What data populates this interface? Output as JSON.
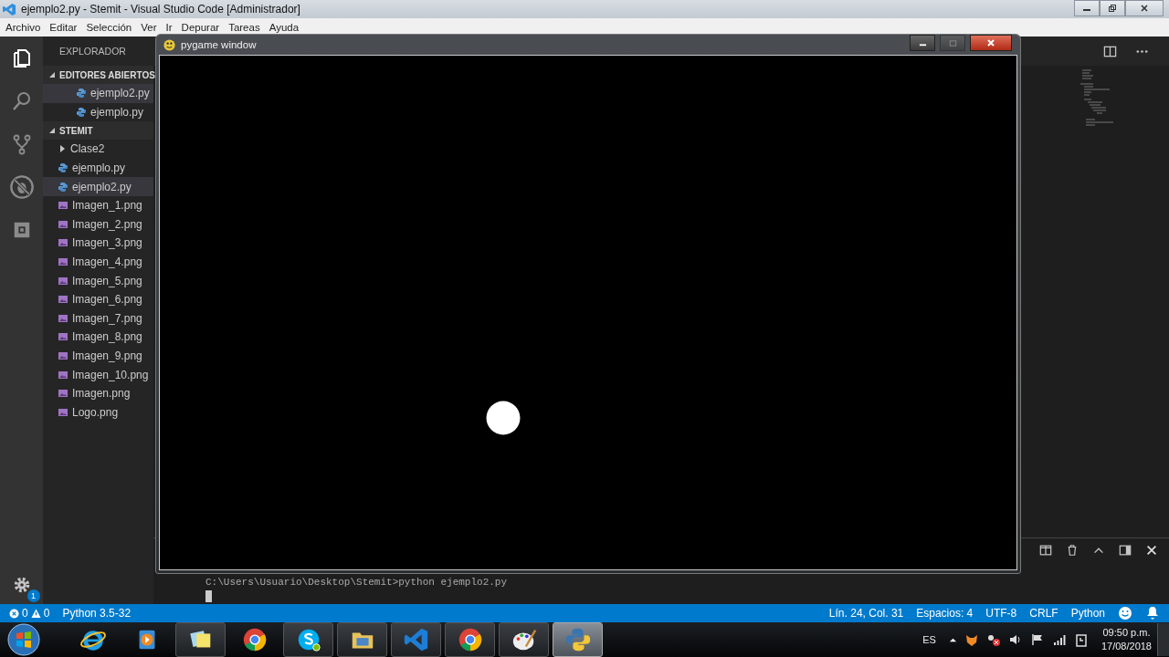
{
  "window": {
    "title": "ejemplo2.py - Stemit - Visual Studio Code [Administrador]"
  },
  "menu": [
    "Archivo",
    "Editar",
    "Selección",
    "Ver",
    "Ir",
    "Depurar",
    "Tareas",
    "Ayuda"
  ],
  "activity_bar": [
    {
      "kind": "files",
      "selected": true
    },
    {
      "kind": "search",
      "selected": false
    },
    {
      "kind": "git",
      "selected": false
    },
    {
      "kind": "debug",
      "selected": false
    },
    {
      "kind": "extensions",
      "selected": false
    }
  ],
  "settings_badge": "1",
  "sidebar": {
    "title": "EXPLORADOR",
    "sections": [
      {
        "title": "EDITORES ABIERTOS",
        "expanded": true,
        "items": [
          {
            "name": "ejemplo2.py",
            "kind": "python",
            "selected": true
          },
          {
            "name": "ejemplo.py",
            "kind": "python",
            "selected": false
          }
        ]
      },
      {
        "title": "STEMIT",
        "expanded": true,
        "items": [
          {
            "name": "Clase2",
            "kind": "folder",
            "expanded": false,
            "selected": false
          },
          {
            "name": "ejemplo.py",
            "kind": "python",
            "selected": false
          },
          {
            "name": "ejemplo2.py",
            "kind": "python",
            "selected": true
          },
          {
            "name": "Imagen_1.png",
            "kind": "image",
            "selected": false
          },
          {
            "name": "Imagen_2.png",
            "kind": "image",
            "selected": false
          },
          {
            "name": "Imagen_3.png",
            "kind": "image",
            "selected": false
          },
          {
            "name": "Imagen_4.png",
            "kind": "image",
            "selected": false
          },
          {
            "name": "Imagen_5.png",
            "kind": "image",
            "selected": false
          },
          {
            "name": "Imagen_6.png",
            "kind": "image",
            "selected": false
          },
          {
            "name": "Imagen_7.png",
            "kind": "image",
            "selected": false
          },
          {
            "name": "Imagen_8.png",
            "kind": "image",
            "selected": false
          },
          {
            "name": "Imagen_9.png",
            "kind": "image",
            "selected": false
          },
          {
            "name": "Imagen_10.png",
            "kind": "image",
            "selected": false
          },
          {
            "name": "Imagen.png",
            "kind": "image",
            "selected": false
          },
          {
            "name": "Logo.png",
            "kind": "image",
            "selected": false
          }
        ]
      }
    ]
  },
  "terminal": {
    "lines": [
      "C:\\Users\\Usuario\\Desktop\\Stemit>python ejemplo2.py"
    ]
  },
  "pygame_window": {
    "title": "pygame window"
  },
  "status_bar": {
    "errors": "0",
    "warnings": "0",
    "interpreter": "Python 3.5-32",
    "right": [
      "Lín. 24, Col. 31",
      "Espacios: 4",
      "UTF-8",
      "CRLF",
      "Python"
    ]
  },
  "taskbar": {
    "apps": [
      {
        "kind": "ie",
        "running": false,
        "selected": false
      },
      {
        "kind": "media",
        "running": false,
        "selected": false
      },
      {
        "kind": "notes",
        "running": true,
        "selected": false
      },
      {
        "kind": "chrome",
        "running": false,
        "selected": false
      },
      {
        "kind": "skype",
        "running": true,
        "selected": false
      },
      {
        "kind": "folder",
        "running": true,
        "selected": false
      },
      {
        "kind": "vscode",
        "running": true,
        "selected": false
      },
      {
        "kind": "chrome",
        "running": true,
        "selected": false
      },
      {
        "kind": "paint",
        "running": true,
        "selected": false
      },
      {
        "kind": "python",
        "running": true,
        "selected": true
      }
    ],
    "language": "ES",
    "time": "09:50 p.m.",
    "date": "17/08/2018"
  }
}
